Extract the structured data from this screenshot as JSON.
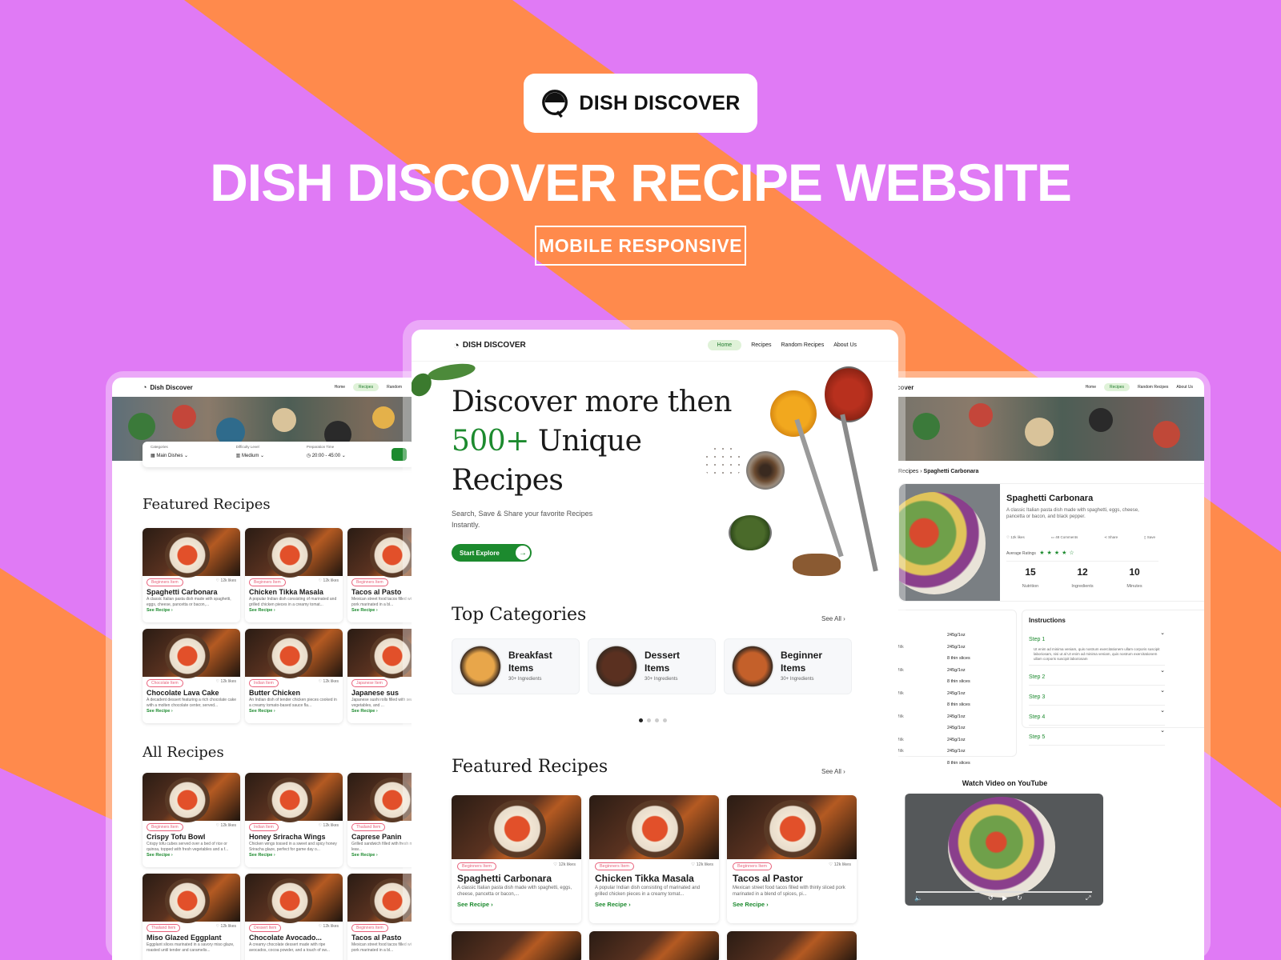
{
  "brand": {
    "logo_text": "DISH DISCOVER"
  },
  "headline": "DISH DISCOVER RECIPE WEBSITE",
  "badge": "MOBILE RESPONSIVE",
  "colors": {
    "purple": "#e07af5",
    "orange": "#ff8a4c",
    "green": "#1c8a2e",
    "white": "#ffffff"
  },
  "center": {
    "brand": "DISH DISCOVER",
    "nav": [
      "Home",
      "Recipes",
      "Random Recipes",
      "About Us"
    ],
    "hero_line1": "Discover more then",
    "hero_line2a": "500+",
    "hero_line2b": " Unique",
    "hero_line3": "Recipes",
    "hero_sub": "Search, Save & Share your favorite Recipes Instantly.",
    "cta": "Start Explore",
    "top_categories": "Top Categories",
    "see_all": "See All",
    "categories": [
      {
        "name": "Breakfast Items",
        "sub": "30+ Ingredients"
      },
      {
        "name": "Dessert Items",
        "sub": "30+ Ingredients"
      },
      {
        "name": "Beginner Items",
        "sub": "30+ Ingredients"
      }
    ],
    "featured": "Featured Recipes",
    "recipes": [
      {
        "tag": "Beginners Item",
        "likes": "12k likes",
        "title": "Spaghetti Carbonara",
        "desc": "A classic Italian pasta dish made with spaghetti, eggs, cheese, pancetta or bacon,...",
        "cta": "See Recipe"
      },
      {
        "tag": "Beginners Item",
        "likes": "12k likes",
        "title": "Chicken Tikka Masala",
        "desc": "A popular Indian dish consisting of marinated and grilled chicken pieces in a creamy tomat...",
        "cta": "See Recipe"
      },
      {
        "tag": "Beginners Item",
        "likes": "12k likes",
        "title": "Tacos al Pastor",
        "desc": "Mexican street food tacos filled with thinly sliced pork marinated in a blend of spices, pi...",
        "cta": "See Recipe"
      }
    ]
  },
  "left": {
    "brand": "Dish Discover",
    "nav": [
      "Home",
      "Recipes",
      "Random"
    ],
    "filters": [
      {
        "label": "Categories",
        "value": "Main Dishes"
      },
      {
        "label": "Difficulty Level",
        "value": "Medium"
      },
      {
        "label": "Preparation Time",
        "value": "20:00 - 45:00"
      }
    ],
    "featured": "Featured Recipes",
    "featured_cards": [
      {
        "tag": "Beginners Item",
        "likes": "12k likes",
        "title": "Spaghetti Carbonara",
        "desc": "A classic Italian pasta dish made with spaghetti, eggs, cheese, pancetta or bacon,...",
        "cta": "See Recipe"
      },
      {
        "tag": "Beginners Item",
        "likes": "12k likes",
        "title": "Chicken Tikka Masala",
        "desc": "A popular Indian dish consisting of marinated and grilled chicken pieces in a creamy tomat...",
        "cta": "See Recipe"
      },
      {
        "tag": "Beginners Item",
        "likes": "12k likes",
        "title": "Tacos al Pasto",
        "desc": "Mexican street food tacos filled with thinly sliced pork marinated in a bl...",
        "cta": "See Recipe"
      },
      {
        "tag": "Chocolate Item",
        "likes": "12k likes",
        "title": "Chocolate Lava Cake",
        "desc": "A decadent dessert featuring a rich chocolate cake with a molten chocolate center, served...",
        "cta": "See Recipe"
      },
      {
        "tag": "Indian Item",
        "likes": "12k likes",
        "title": "Butter Chicken",
        "desc": "An Indian dish of tender chicken pieces cooked in a creamy tomato-based sauce fla...",
        "cta": "See Recipe"
      },
      {
        "tag": "Japanese Item",
        "likes": "12k likes",
        "title": "Japanese sus",
        "desc": "Japanese sushi rolls filled with seafood, vegetables, and ...",
        "cta": "See Recipe"
      }
    ],
    "all": "All Recipes",
    "all_cards": [
      {
        "tag": "Beginners Item",
        "likes": "12k likes",
        "title": "Crispy Tofu Bowl",
        "desc": "Crispy tofu cubes served over a bed of rice or quinoa, topped with fresh vegetables and a f...",
        "cta": "See Recipe"
      },
      {
        "tag": "Indian Item",
        "likes": "12k likes",
        "title": "Honey Sriracha Wings",
        "desc": "Chicken wings tossed in a sweet and spicy honey Sriracha glaze, perfect for game day o...",
        "cta": "See Recipe"
      },
      {
        "tag": "Thailand Item",
        "likes": "12k likes",
        "title": "Caprese Panin",
        "desc": "Grilled sandwich filled with fresh mozzarella, basil leav...",
        "cta": "See Recipe"
      },
      {
        "tag": "Thailand Item",
        "likes": "12k likes",
        "title": "Miso Glazed Eggplant",
        "desc": "Eggplant slices marinated in a savory miso glaze, roasted until tender and caramelis...",
        "cta": ""
      },
      {
        "tag": "Dessert Item",
        "likes": "12k likes",
        "title": "Chocolate Avocado...",
        "desc": "A creamy chocolate dessert made with ripe avocados, cocoa powder, and a touch of sw...",
        "cta": ""
      },
      {
        "tag": "Beginners Item",
        "likes": "12k likes",
        "title": "Tacos al Pasto",
        "desc": "Mexican street food tacos filled with thinly sliced pork marinated in a bl...",
        "cta": ""
      }
    ]
  },
  "right": {
    "brand": "cover",
    "nav": [
      "Home",
      "Recipes",
      "Random Recipes",
      "About Us"
    ],
    "breadcrumb_parent": "Recipes",
    "breadcrumb_current": "Spaghetti Carbonara",
    "title": "Spaghetti Carbonara",
    "desc": "A classic Italian pasta dish made with spaghetti, eggs, cheese, pancetta or bacon, and black pepper.",
    "actions": [
      "12k likes",
      "48 Comments",
      "Share",
      "Save"
    ],
    "ratings_label": "Average Ratings",
    "rating": 4,
    "stats": [
      {
        "value": "15",
        "label": "Nutrition"
      },
      {
        "value": "12",
        "label": "Ingredients"
      },
      {
        "value": "10",
        "label": "Minutes"
      }
    ],
    "ingredients_title": "ents",
    "ingredients": [
      {
        "name": "",
        "qty": "245g/1oz"
      },
      {
        "name": "Cream Milk",
        "qty": "245g/1oz"
      },
      {
        "name": "",
        "qty": "8 thin slices"
      },
      {
        "name": "Cream Milk",
        "qty": "245g/1oz"
      },
      {
        "name": "",
        "qty": "8 thin slices"
      },
      {
        "name": "Cream Milk",
        "qty": "245g/1oz"
      },
      {
        "name": "",
        "qty": "8 thin slices"
      },
      {
        "name": "Cream Milk",
        "qty": "245g/1oz"
      },
      {
        "name": "",
        "qty": "245g/1oz"
      },
      {
        "name": "Cream Milk",
        "qty": "245g/1oz"
      },
      {
        "name": "Cream Milk",
        "qty": "245g/1oz"
      },
      {
        "name": "",
        "qty": "8 thin slices"
      }
    ],
    "instructions_title": "Instructions",
    "steps": [
      "Step 1",
      "Step 2",
      "Step 3",
      "Step 4",
      "Step 5"
    ],
    "step1_text": "Ut enim ad minima veniam, quis nostrum exercitationem ullam corporis suscipit laboriosam, nisi ut al Ut enim ad minima veniam, quis nostrum exercitationem ullam corporis suscipit laboriosam",
    "video_title": "Watch Video on YouTube"
  }
}
